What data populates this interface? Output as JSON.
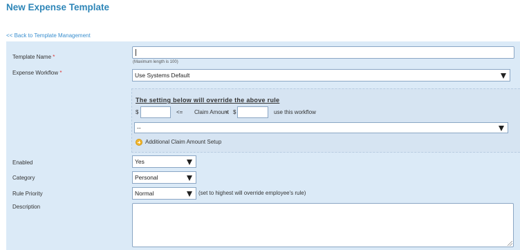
{
  "page": {
    "title": "New Expense Template",
    "back_link": "<< Back to Template Management"
  },
  "form": {
    "template_name": {
      "label": "Template Name",
      "required_mark": "*",
      "value": "",
      "hint": "(Maximum length is 100)"
    },
    "expense_workflow": {
      "label": "Expense Workflow",
      "required_mark": "*",
      "selected": "Use Systems Default"
    },
    "override": {
      "title": "The setting below will override the above rule",
      "currency_symbol_1": "$",
      "min_value": "",
      "comparison_1": "<=",
      "claim_amount_label": "Claim Amount",
      "comparison_2": "<",
      "currency_symbol_2": "$",
      "max_value": "",
      "suffix": "use this workflow",
      "workflow_selected": "--",
      "additional_setup_label": "Additional Claim Amount Setup"
    },
    "enabled": {
      "label": "Enabled",
      "selected": "Yes"
    },
    "category": {
      "label": "Category",
      "selected": "Personal"
    },
    "rule_priority": {
      "label": "Rule Priority",
      "selected": "Normal",
      "note": "(set to highest will override employee's rule)"
    },
    "description": {
      "label": "Description",
      "value": ""
    }
  },
  "icons": {
    "add_setup": "plus-circle-icon",
    "dropdown": "triangle-down-icon"
  },
  "colors": {
    "title": "#2e86b8",
    "link": "#3a8fcf",
    "panel": "#dbeaf7",
    "required": "#dd3333"
  }
}
